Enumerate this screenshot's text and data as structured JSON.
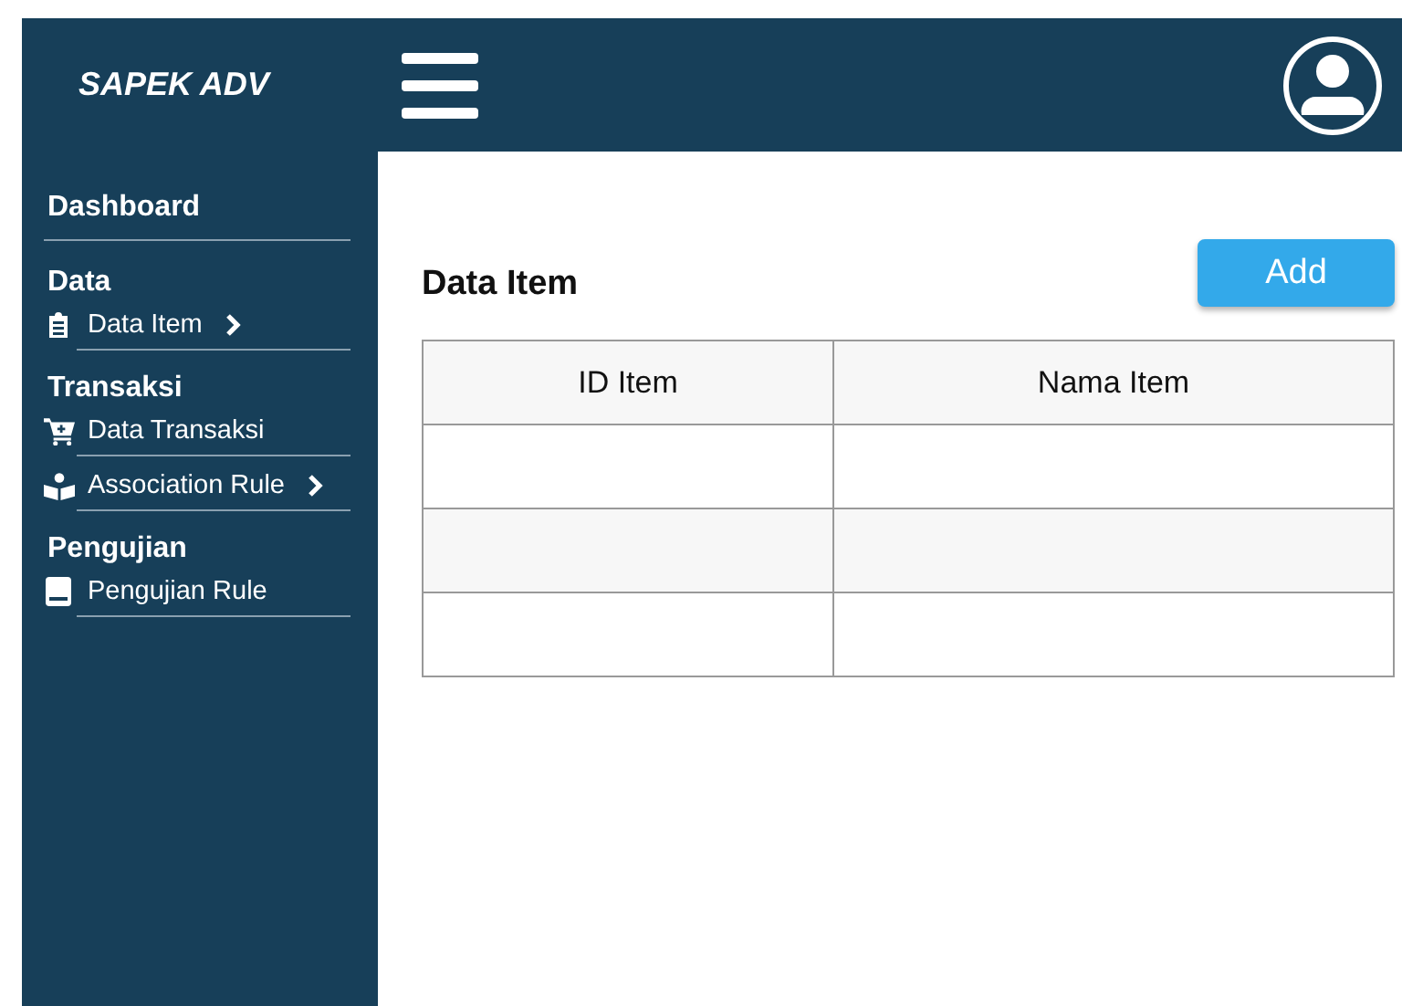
{
  "topbar": {
    "brand": "SAPEK ADV"
  },
  "sidebar": {
    "sections": [
      {
        "heading": "Dashboard"
      },
      {
        "heading": "Data",
        "items": [
          {
            "label": "Data Item",
            "kind": "clipboard",
            "submenu": true
          }
        ]
      },
      {
        "heading": "Transaksi",
        "items": [
          {
            "label": "Data Transaksi",
            "kind": "cart",
            "submenu": false
          },
          {
            "label": "Association Rule",
            "kind": "reader",
            "submenu": true
          }
        ]
      },
      {
        "heading": "Pengujian",
        "items": [
          {
            "label": "Pengujian Rule",
            "kind": "book",
            "submenu": false
          }
        ]
      }
    ]
  },
  "main": {
    "title": "Data Item",
    "add_button": "Add",
    "table": {
      "columns": [
        "ID Item",
        "Nama Item"
      ]
    }
  }
}
